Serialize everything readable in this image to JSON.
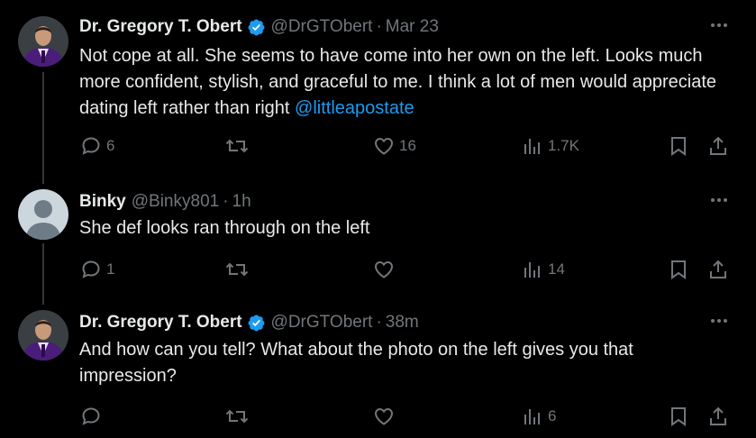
{
  "tweets": [
    {
      "name": "Dr. Gregory T. Obert",
      "handle": "@DrGTObert",
      "time": "Mar 23",
      "text": "Not cope at all.  She seems to have come into her own on the left.  Looks much more confident, stylish, and graceful to me.  I think a lot of men would appreciate dating left rather than right ",
      "mention": "@littleapostate",
      "replies": "6",
      "retweets": "",
      "likes": "16",
      "views": "1.7K"
    },
    {
      "name": "Binky",
      "handle": "@Binky801",
      "time": "1h",
      "text": "She def looks ran through on the left",
      "replies": "1",
      "retweets": "",
      "likes": "",
      "views": "14"
    },
    {
      "name": "Dr. Gregory T. Obert",
      "handle": "@DrGTObert",
      "time": "38m",
      "text": "And how can you tell?  What about the photo on the left gives you that impression?",
      "replies": "",
      "retweets": "",
      "likes": "",
      "views": "6"
    }
  ],
  "separator": "·",
  "colors": {
    "background": "#000000",
    "text": "#e7e9ea",
    "secondary": "#71767b",
    "accent": "#1d9bf0",
    "verified_badge": "#1d9bf0"
  }
}
